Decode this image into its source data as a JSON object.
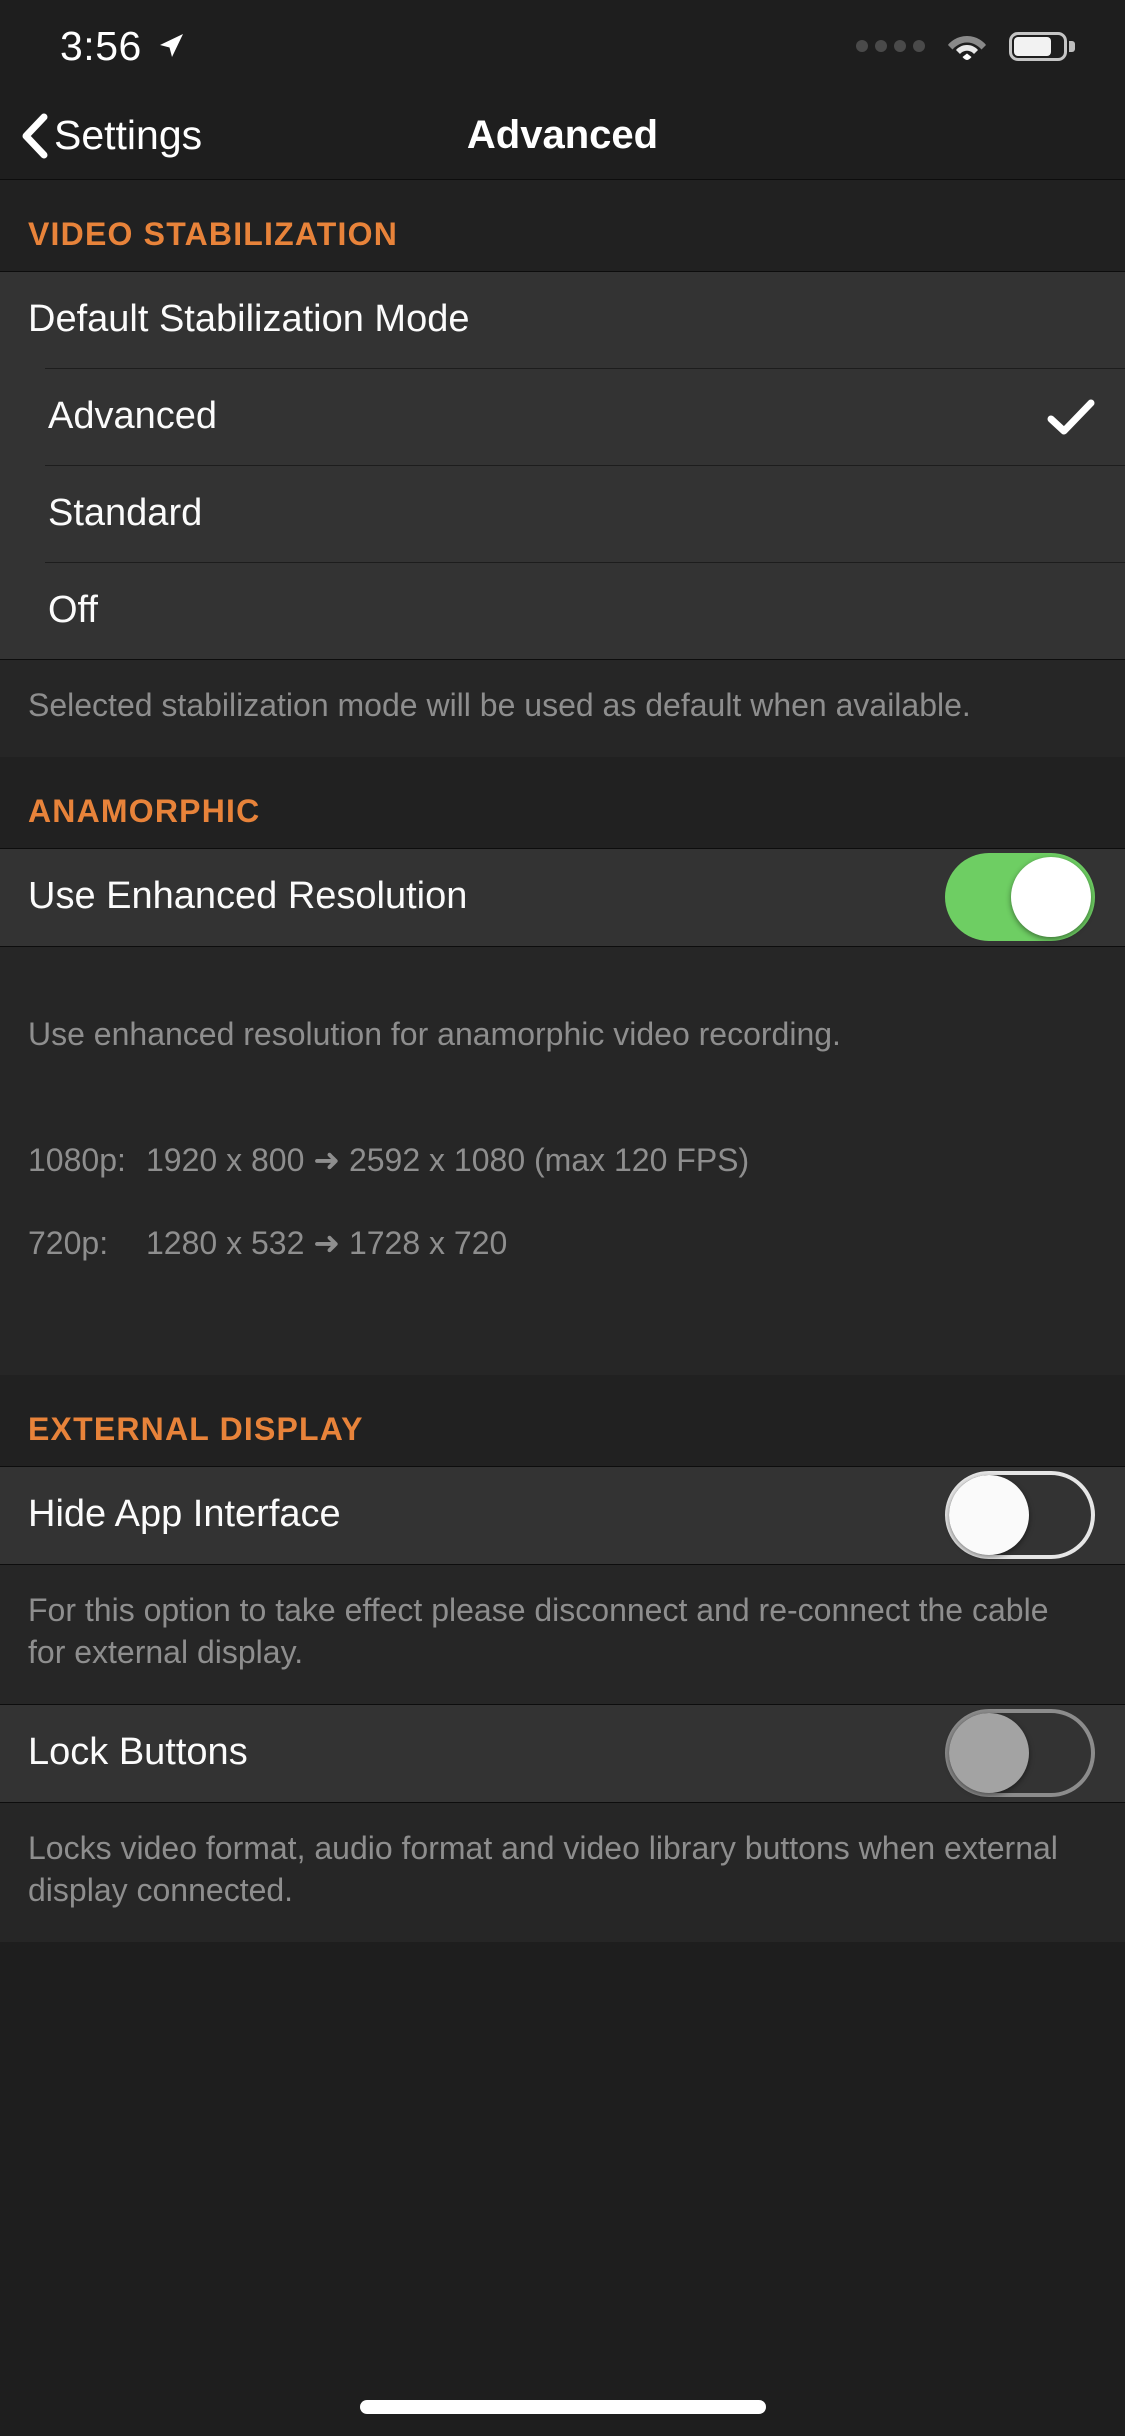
{
  "status_bar": {
    "time": "3:56",
    "location_icon": "location-arrow-icon",
    "signal_icon": "signal-dots-icon",
    "wifi_icon": "wifi-icon",
    "battery_icon": "battery-icon"
  },
  "nav": {
    "back_label": "Settings",
    "back_icon": "chevron-left-icon",
    "title": "Advanced"
  },
  "accent_color": "#e8833a",
  "switch_on_color": "#6ece63",
  "sections": [
    {
      "header": "VIDEO STABILIZATION",
      "rows": [
        {
          "label": "Default Stabilization Mode",
          "type": "header-row"
        },
        {
          "label": "Advanced",
          "type": "option",
          "selected": true,
          "check_icon": "checkmark-icon"
        },
        {
          "label": "Standard",
          "type": "option",
          "selected": false
        },
        {
          "label": "Off",
          "type": "option",
          "selected": false
        }
      ],
      "footer": "Selected stabilization mode will be used as default when available."
    },
    {
      "header": "ANAMORPHIC",
      "rows": [
        {
          "label": "Use Enhanced Resolution",
          "type": "switch",
          "state": "on"
        }
      ],
      "footer": "Use enhanced resolution for anamorphic video recording.",
      "footer_rows": [
        {
          "key": "1080p:",
          "value": "1920 x 800 ➜ 2592 x 1080 (max 120 FPS)"
        },
        {
          "key": "720p:",
          "value": "1280 x 532 ➜ 1728 x 720"
        }
      ]
    },
    {
      "header": "EXTERNAL DISPLAY",
      "rows": [
        {
          "label": "Hide App Interface",
          "type": "switch",
          "state": "off"
        }
      ],
      "footer": "For this option to take effect please disconnect and re-connect the cable for external display."
    },
    {
      "header": "",
      "rows": [
        {
          "label": "Lock Buttons",
          "type": "switch",
          "state": "disabled"
        }
      ],
      "footer": "Locks video format, audio format and video library buttons when external display connected."
    }
  ],
  "home_indicator": "home-indicator"
}
